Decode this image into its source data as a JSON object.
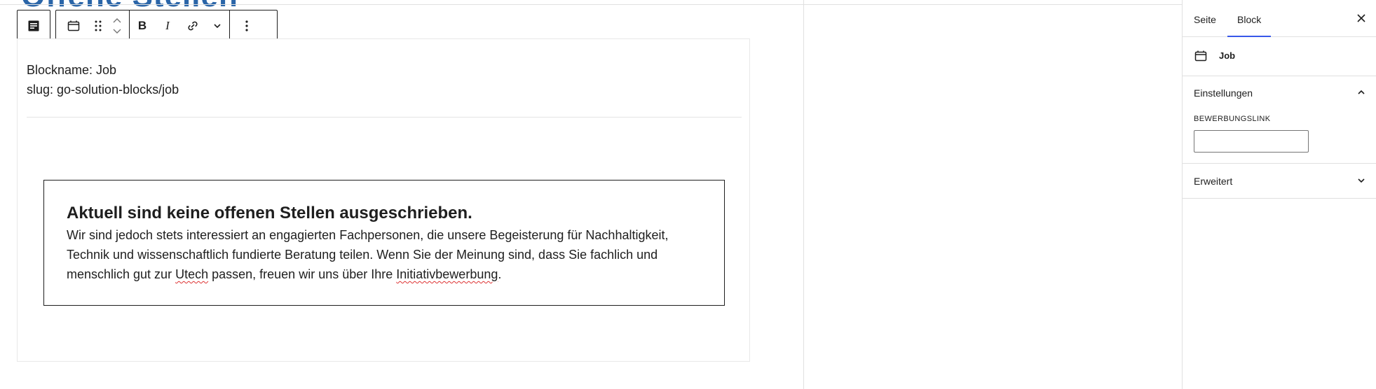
{
  "page": {
    "heading_peek": "Offene Stellen"
  },
  "toolbar": {
    "parent_icon": "post-content-icon",
    "block_type_icon": "calendar-icon",
    "drag_icon": "drag-handle-icon",
    "move_up_icon": "chevron-up-icon",
    "move_down_icon": "chevron-down-icon",
    "bold_label": "B",
    "italic_label": "I",
    "link_icon": "link-icon",
    "more_format_icon": "chevron-down-icon",
    "options_icon": "more-vertical-icon"
  },
  "block": {
    "name_line": "Blockname: Job",
    "slug_line": "slug: go-solution-blocks/job",
    "notice": {
      "title": "Aktuell sind keine offenen Stellen ausgeschrieben.",
      "text_part1": "Wir sind jedoch stets interessiert an engagierten Fachpersonen, die unsere Begeisterung für Nachhaltigkeit, Technik und wissenschaftlich fundierte Beratung teilen. Wenn Sie der Meinung sind, dass Sie fachlich und menschlich gut zur ",
      "text_company": "Utech",
      "text_part2": " passen, freuen wir uns über Ihre ",
      "text_link_word": "Initiativbewerbung",
      "text_end": "."
    }
  },
  "sidebar": {
    "tabs": [
      {
        "label": "Seite",
        "active": false
      },
      {
        "label": "Block",
        "active": true
      }
    ],
    "close_icon": "close-icon",
    "block_card": {
      "icon": "calendar-icon",
      "title": "Job"
    },
    "settings": {
      "title": "Einstellungen",
      "expanded": true,
      "field_label": "BEWERBUNGSLINK",
      "field_value": ""
    },
    "advanced": {
      "title": "Erweitert",
      "expanded": false
    }
  },
  "colors": {
    "accent": "#3858e9",
    "heading_blue": "#2a65a8",
    "spellcheck": "#dd3333"
  }
}
